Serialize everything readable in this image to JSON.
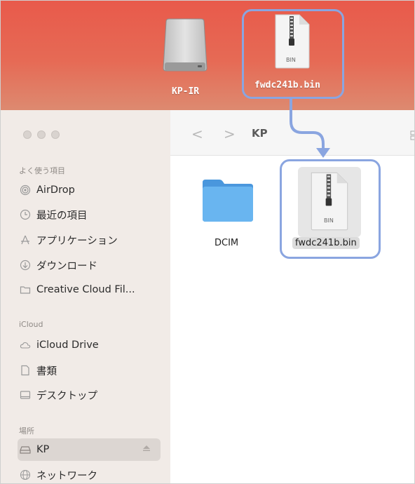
{
  "desktop": {
    "drive_label": "KP-IR",
    "file_label": "fwdc241b.bin",
    "file_badge": "BIN"
  },
  "sidebar": {
    "favorites_header": "よく使う項目",
    "favorites": [
      {
        "label": "AirDrop",
        "icon": "airdrop-icon"
      },
      {
        "label": "最近の項目",
        "icon": "clock-icon"
      },
      {
        "label": "アプリケーション",
        "icon": "applications-icon"
      },
      {
        "label": "ダウンロード",
        "icon": "download-icon"
      },
      {
        "label": "Creative Cloud Fil...",
        "icon": "folder-icon"
      }
    ],
    "icloud_header": "iCloud",
    "icloud": [
      {
        "label": "iCloud Drive",
        "icon": "cloud-icon"
      },
      {
        "label": "書類",
        "icon": "document-icon"
      },
      {
        "label": "デスクトップ",
        "icon": "desktop-icon"
      }
    ],
    "locations_header": "場所",
    "locations": [
      {
        "label": "KP",
        "icon": "drive-icon",
        "selected": true
      },
      {
        "label": "ネットワーク",
        "icon": "network-icon"
      }
    ]
  },
  "toolbar": {
    "back_glyph": "<",
    "forward_glyph": ">",
    "path_title": "KP"
  },
  "content": {
    "items": [
      {
        "label": "DCIM",
        "kind": "folder"
      },
      {
        "label": "fwdc241b.bin",
        "kind": "bin-file",
        "badge": "BIN",
        "selected": true
      }
    ]
  },
  "colors": {
    "desktop_top": "#e85a4b",
    "folder_blue": "#5aa8e8",
    "annotation": "#8aa5e0",
    "sidebar_bg": "#f1ebe7"
  }
}
